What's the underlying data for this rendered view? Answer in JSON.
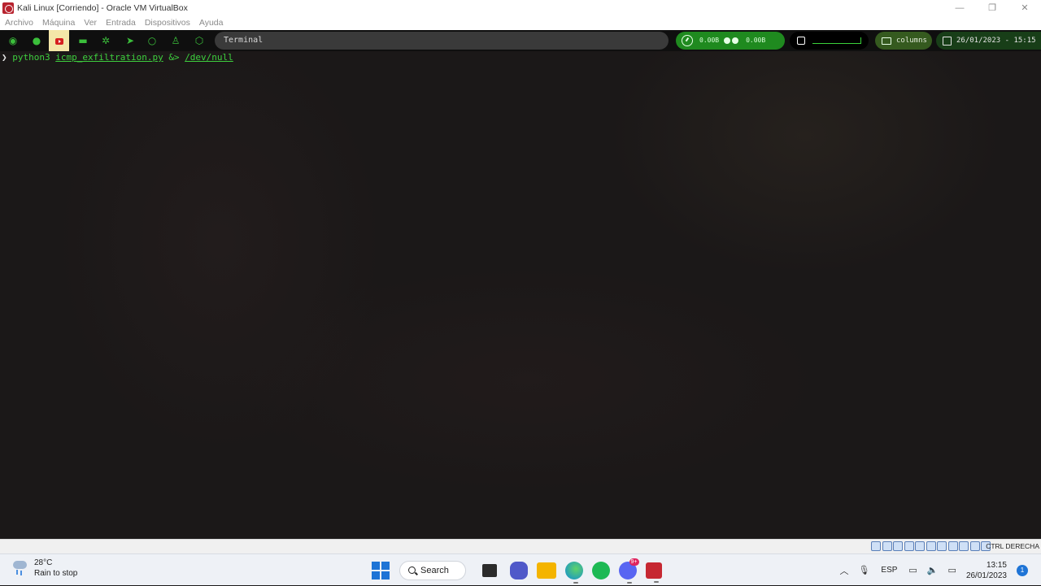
{
  "window": {
    "title": "Kali Linux [Corriendo] - Oracle VM VirtualBox",
    "controls": {
      "minimize": "—",
      "maximize": "❐",
      "close": "✕"
    }
  },
  "menu": [
    "Archivo",
    "Máquina",
    "Ver",
    "Entrada",
    "Dispositivos",
    "Ayuda"
  ],
  "polybar": {
    "workspace_icons": [
      "kali-dragon-icon",
      "debian-swirl-icon",
      "youtube-icon",
      "folder-icon",
      "gear-icon",
      "telegram-icon",
      "github-icon",
      "linux-icon",
      "package-icon"
    ],
    "active_window": "Terminal",
    "net_down": "0.00B",
    "net_up": "0.00B",
    "layout": "columns",
    "datetime": "26/01/2023 - 15:15",
    "accent": "#3bbf3b"
  },
  "terminal": {
    "prompt_symbol": "❯",
    "command": "python3",
    "arg": "icmp_exfiltration.py",
    "redirect": "&>",
    "target": "/dev/null"
  },
  "vbox_status": {
    "host_key": "CTRL DERECHA"
  },
  "taskbar": {
    "weather": {
      "temp": "28°C",
      "condition": "Rain to stop"
    },
    "search_label": "Search",
    "apps": [
      {
        "name": "task-view-icon",
        "color": "#2b2b2b",
        "running": false
      },
      {
        "name": "teams-icon",
        "color": "#5059c9",
        "running": false
      },
      {
        "name": "file-explorer-icon",
        "color": "#f4b400",
        "running": false
      },
      {
        "name": "edge-icon",
        "color": "#0f8bd6",
        "running": true
      },
      {
        "name": "spotify-icon",
        "color": "#1db954",
        "running": false
      },
      {
        "name": "discord-icon",
        "color": "#5865f2",
        "running": true,
        "badge": "9+"
      },
      {
        "name": "virtualbox-icon",
        "color": "#c62832",
        "running": true
      }
    ],
    "language": "ESP",
    "time": "13:15",
    "date": "26/01/2023",
    "notifications": "1"
  }
}
